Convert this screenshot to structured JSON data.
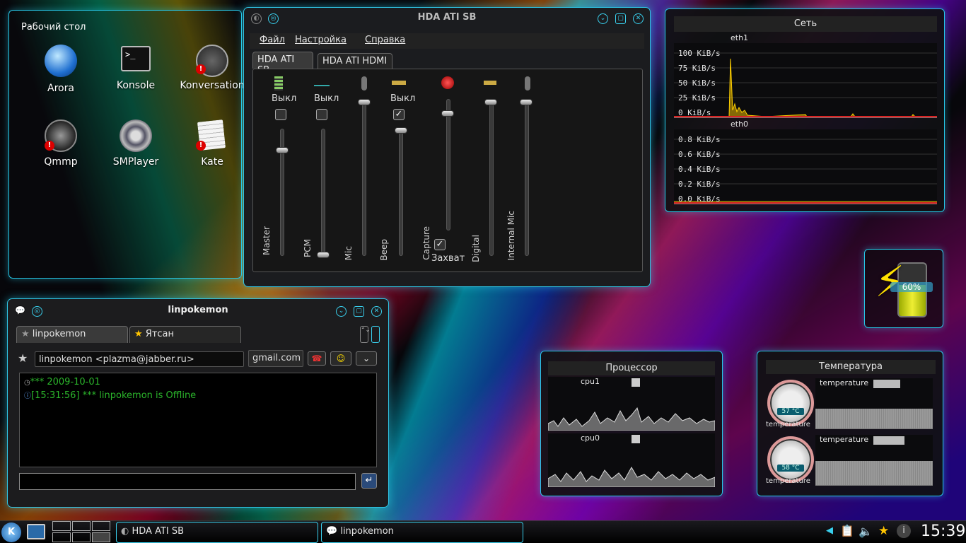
{
  "desktop": {
    "folder_title": "Рабочий стол",
    "icons": [
      {
        "label": "Arora",
        "icon": "arora-icon"
      },
      {
        "label": "Konsole",
        "icon": "terminal-icon"
      },
      {
        "label": "Konversation",
        "icon": "megaphone-icon"
      },
      {
        "label": "Qmmp",
        "icon": "butterfly-icon"
      },
      {
        "label": "SMPlayer",
        "icon": "film-reel-icon"
      },
      {
        "label": "Kate",
        "icon": "text-editor-icon"
      }
    ]
  },
  "mixer": {
    "title": "HDA ATI SB",
    "menu": [
      "Файл",
      "Настройка",
      "Справка"
    ],
    "tabs": [
      "HDA ATI SB",
      "HDA ATI HDMI"
    ],
    "channels": [
      {
        "name": "Master",
        "mute_label": "Выкл",
        "muted": false,
        "level": 0.78
      },
      {
        "name": "PCM",
        "mute_label": "Выкл",
        "muted": false,
        "level": 0.0
      },
      {
        "name": "Mic",
        "level": 1.0
      },
      {
        "name": "Beep",
        "mute_label": "Выкл",
        "muted": true,
        "level": 0.95
      },
      {
        "name": "Capture",
        "capture_label": "Захват",
        "captured": true,
        "level": 0.82
      },
      {
        "name": "Digital",
        "level": 1.0
      },
      {
        "name": "Internal Mic",
        "level": 1.0
      }
    ]
  },
  "network": {
    "title": "Сеть",
    "interfaces": [
      {
        "name": "eth1",
        "ticks": [
          "100 KiB/s",
          "75 KiB/s",
          "50 KiB/s",
          "25 KiB/s",
          "0 KiB/s"
        ]
      },
      {
        "name": "eth0",
        "ticks": [
          "0.8 KiB/s",
          "0.6 KiB/s",
          "0.4 KiB/s",
          "0.2 KiB/s",
          "0.0 KiB/s"
        ]
      }
    ]
  },
  "battery": {
    "percent": "60%",
    "level": 0.6
  },
  "cpu": {
    "title": "Процессор",
    "cores": [
      {
        "name": "cpu1"
      },
      {
        "name": "cpu0"
      }
    ]
  },
  "temperature": {
    "title": "Температура",
    "sensors": [
      {
        "label": "temperature",
        "gauge_label": "temperature",
        "value": "57 °C"
      },
      {
        "label": "temperature",
        "gauge_label": "temperature",
        "value": "58 °C"
      }
    ]
  },
  "chat": {
    "title": "linpokemon",
    "tabs": [
      "linpokemon",
      "Ятсан"
    ],
    "contact": "linpokemon <plazma@jabber.ru>",
    "account": "gmail.com",
    "messages": [
      "*** 2009-10-01",
      "[15:31:56] *** linpokemon is Offline"
    ],
    "input_value": ""
  },
  "taskbar": {
    "tasks": [
      "HDA ATI SB",
      "linpokemon"
    ],
    "clock": "15:39"
  },
  "colors": {
    "accent": "#2fc4e4",
    "chat_text": "#2bb52b",
    "graph_line": "#ffd000"
  }
}
